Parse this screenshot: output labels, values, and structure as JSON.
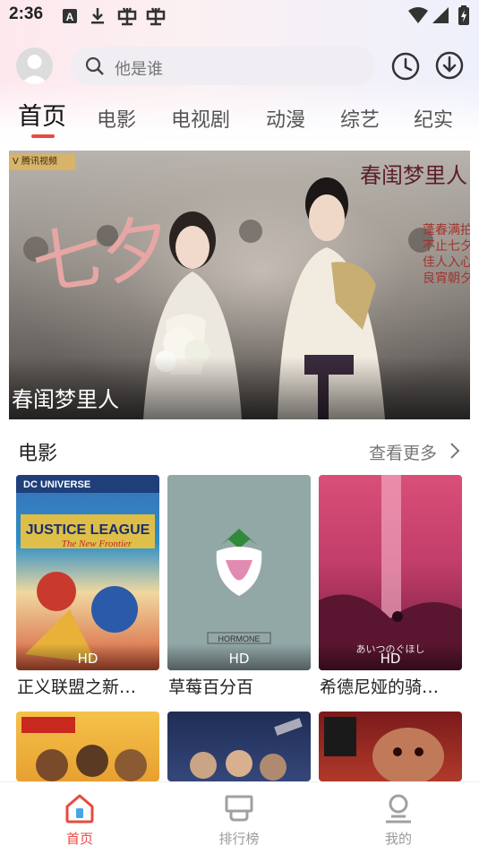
{
  "status_bar": {
    "time": "2:36",
    "icons": [
      "a-icon",
      "download-arrow-icon",
      "bug-icon",
      "bug-icon",
      "wifi-icon",
      "signal-icon",
      "battery-icon"
    ]
  },
  "header": {
    "search_placeholder": "他是谁"
  },
  "tabs": [
    "首页",
    "电影",
    "电视剧",
    "动漫",
    "综艺",
    "纪实"
  ],
  "active_tab": "首页",
  "accent_color": "#e84a3f",
  "banner": {
    "title": "春闺梦里人",
    "calligraphy": "七夕",
    "logo_text": "V 腾讯视频",
    "top_right_text": "春闺梦里人",
    "vertical_text": "蓬春满拍 不止七夕 佳人入心 良宵朝夕"
  },
  "movies_section": {
    "title": "电影",
    "more_label": "查看更多",
    "items": [
      {
        "title": "正义联盟之新…",
        "badge": "HD"
      },
      {
        "title": "草莓百分百",
        "badge": "HD"
      },
      {
        "title": "希德尼娅的骑…",
        "badge": "HD"
      }
    ]
  },
  "bottom_nav": [
    {
      "label": "首页",
      "icon": "home-icon"
    },
    {
      "label": "排行榜",
      "icon": "ranking-icon"
    },
    {
      "label": "我的",
      "icon": "profile-icon"
    }
  ]
}
